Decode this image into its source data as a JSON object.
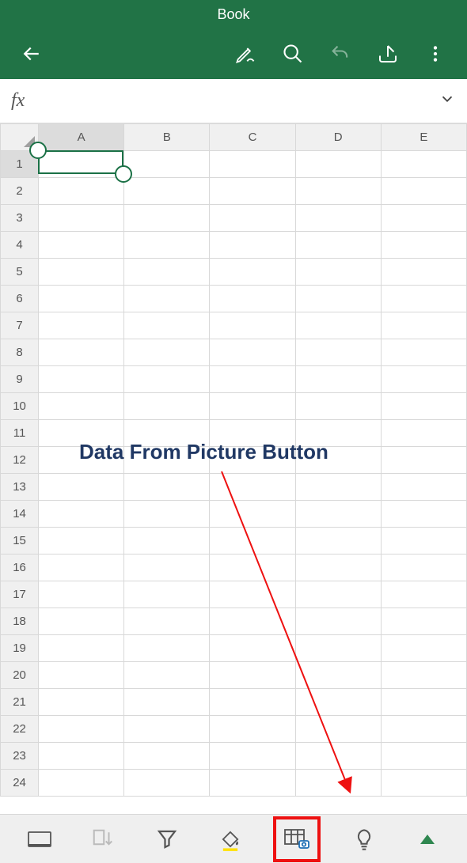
{
  "title": "Book",
  "toolbar": {
    "back": "back-icon",
    "draw": "pen-icon",
    "search": "search-icon",
    "undo": "undo-icon",
    "share": "share-icon",
    "more": "more-icon"
  },
  "formula_bar": {
    "fx_label": "fx",
    "value": ""
  },
  "sheet": {
    "columns": [
      "A",
      "B",
      "C",
      "D",
      "E"
    ],
    "rows": [
      "1",
      "2",
      "3",
      "4",
      "5",
      "6",
      "7",
      "8",
      "9",
      "10",
      "11",
      "12",
      "13",
      "14",
      "15",
      "16",
      "17",
      "18",
      "19",
      "20",
      "21",
      "22",
      "23",
      "24"
    ],
    "selected_cell": "A1"
  },
  "annotation": {
    "text": "Data From Picture Button"
  },
  "bottombar": {
    "card_view": "card-view-icon",
    "sort": "sort-icon",
    "filter": "filter-icon",
    "fill_color": "fill-color-icon",
    "data_from_picture": "data-from-picture-icon",
    "ideas": "lightbulb-icon",
    "expand": "expand-icon"
  }
}
